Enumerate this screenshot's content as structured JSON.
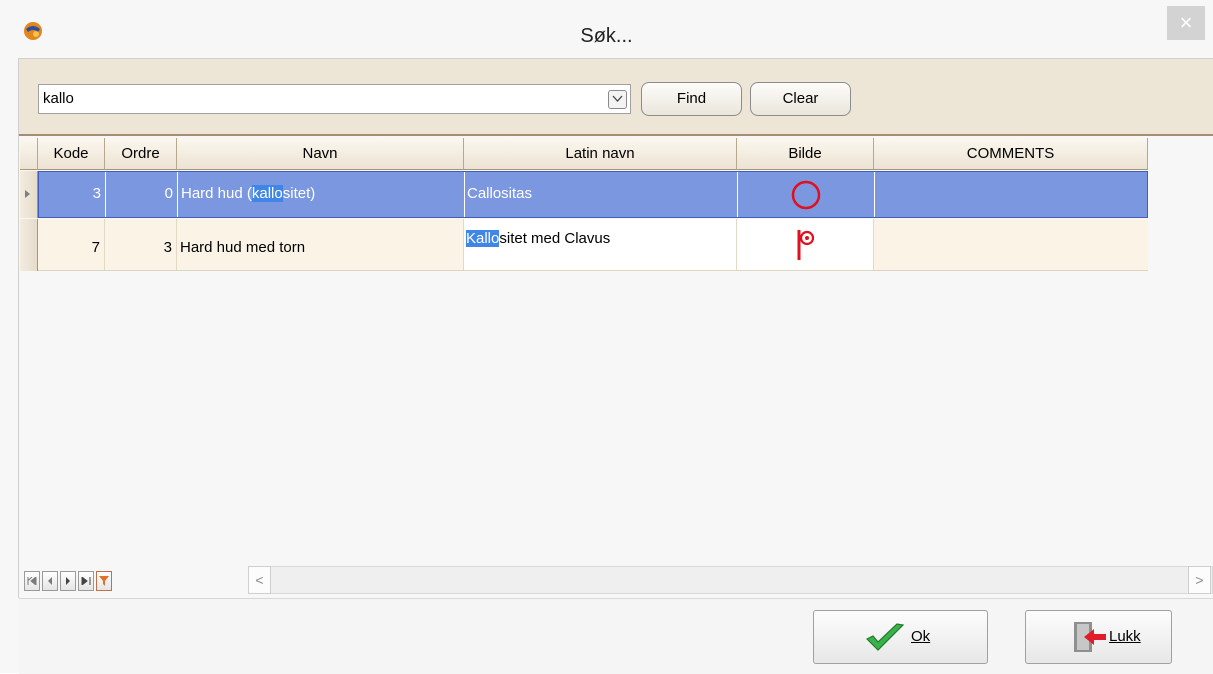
{
  "window": {
    "title": "Søk...",
    "close_label": "×"
  },
  "search": {
    "value": "kallo",
    "find_label": "Find",
    "clear_label": "Clear"
  },
  "grid": {
    "columns": [
      "Kode",
      "Ordre",
      "Navn",
      "Latin navn",
      "Bilde",
      "COMMENTS"
    ],
    "rows": [
      {
        "kode": "3",
        "ordre": "0",
        "navn_before": "Hard hud (",
        "navn_match": "kallo",
        "navn_after": "sitet)",
        "latin_before": "Callositas",
        "latin_match": "",
        "latin_after": "",
        "bilde_icon": "circle-icon",
        "comments": "",
        "selected": true
      },
      {
        "kode": "7",
        "ordre": "3",
        "navn_before": "Hard hud med torn",
        "navn_match": "",
        "navn_after": "",
        "latin_before": "",
        "latin_match": "Kallo",
        "latin_after": "sitet med Clavus",
        "bilde_icon": "flag-circle-icon",
        "comments": "",
        "selected": false
      }
    ]
  },
  "navigator": {
    "scroll_left": "<",
    "scroll_right": ">"
  },
  "footer": {
    "ok_label": "Ok",
    "close_label": "Lukk"
  },
  "colors": {
    "selection": "#7b97e0",
    "highlight": "#3f86e8",
    "symbol_red": "#e0101e"
  }
}
